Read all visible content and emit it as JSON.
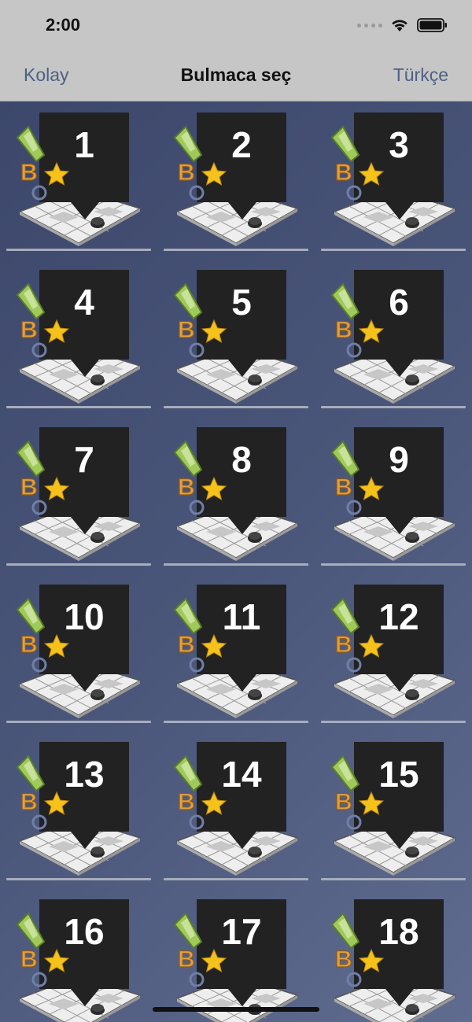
{
  "status": {
    "time": "2:00"
  },
  "nav": {
    "left": "Kolay",
    "title": "Bulmaca seç",
    "right": "Türkçe"
  },
  "icons": [
    "signal-dots-icon",
    "wifi-icon",
    "battery-icon",
    "star-icon",
    "pencil-icon"
  ],
  "puzzles": [
    {
      "label": "1"
    },
    {
      "label": "2"
    },
    {
      "label": "3"
    },
    {
      "label": "4"
    },
    {
      "label": "5"
    },
    {
      "label": "6"
    },
    {
      "label": "7"
    },
    {
      "label": "8"
    },
    {
      "label": "9"
    },
    {
      "label": "10"
    },
    {
      "label": "11"
    },
    {
      "label": "12"
    },
    {
      "label": "13"
    },
    {
      "label": "14"
    },
    {
      "label": "15"
    },
    {
      "label": "16"
    },
    {
      "label": "17"
    },
    {
      "label": "18"
    }
  ],
  "colors": {
    "accent": "#4d6185",
    "card": "#222222",
    "star": "#f5c21b",
    "pencil_green": "#9fca5a",
    "letter_b": "#e0a043"
  }
}
